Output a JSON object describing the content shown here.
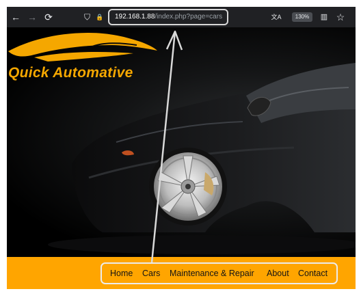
{
  "browser": {
    "back_icon": "←",
    "forward_icon": "→",
    "reload_icon": "⟳",
    "shield_icon": "⛉",
    "lock_icon": "🔒",
    "url_host": "192.168.1.88",
    "url_path": "/index.php?page=cars",
    "translate_icon": "文A",
    "zoom_level": "130%",
    "reader_icon": "▥",
    "bookmark_icon": "☆"
  },
  "site": {
    "brand_name": "Quick Automative",
    "brand_color": "#f5a700"
  },
  "nav": {
    "items": [
      {
        "label": "Home"
      },
      {
        "label": "Cars"
      },
      {
        "label": "Maintenance & Repair"
      },
      {
        "label": "About"
      },
      {
        "label": "Contact"
      }
    ],
    "bar_color": "#ffa500"
  }
}
